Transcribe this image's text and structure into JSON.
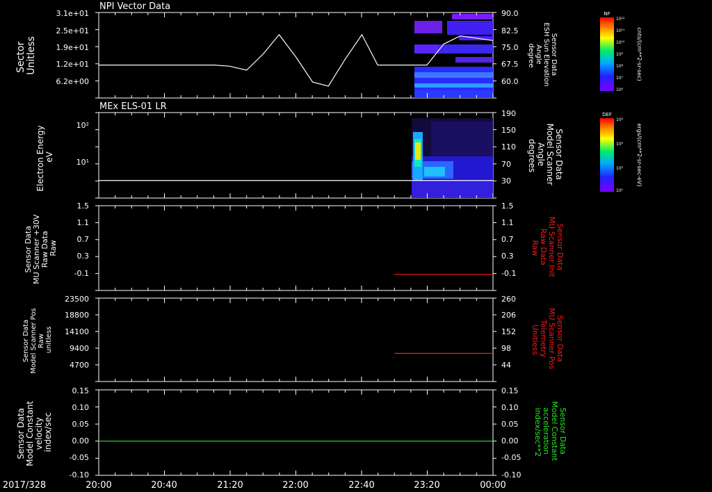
{
  "date_label": "2017/328",
  "time_ticks": [
    "20:00",
    "20:40",
    "21:20",
    "22:00",
    "22:40",
    "23:20",
    "00:00"
  ],
  "colors": {
    "axis": "#ffffff",
    "red": "#ff1a1a",
    "green": "#22ee22",
    "bg": "#000000"
  },
  "chart_data": [
    {
      "type": "line",
      "title": "NPI Vector Data",
      "ylabel_left": [
        "Sector",
        "Unitless"
      ],
      "ylabel_right": [
        "Sensor Data",
        "ESH Sun Elevation",
        "Angle",
        "degree"
      ],
      "left_ticks": [
        "3.1e+01",
        "2.5e+01",
        "1.9e+01",
        "1.2e+01",
        "6.2e+00"
      ],
      "right_ticks": [
        "90.0",
        "82.5",
        "75.0",
        "67.5",
        "60.0"
      ],
      "right_ylim": [
        53.4,
        90.0
      ],
      "x_hours": [
        20.0,
        20.33,
        20.83,
        21.17,
        21.33,
        21.5,
        21.67,
        21.83,
        22.0,
        22.17,
        22.33,
        22.5,
        22.67,
        22.83,
        23.0,
        23.17,
        23.33,
        23.5,
        23.67,
        24.0
      ],
      "series": [
        {
          "values": [
            67.5,
            67.5,
            67.5,
            67.5,
            67.0,
            65.3,
            72.3,
            80.5,
            71.0,
            60.2,
            58.5,
            70.0,
            80.5,
            67.5,
            67.5,
            67.5,
            67.5,
            76.5,
            80.0,
            78.0
          ]
        }
      ],
      "spectrogram": {
        "x_range": [
          "23:10",
          "00:00"
        ],
        "colorbar_label": "NF",
        "colorbar_units": "cnts/(cm**2-sr-sec)",
        "colorbar_ticks": [
          "10¹²",
          "10¹¹",
          "10¹⁰",
          "10⁹",
          "10⁸",
          "10⁷",
          "10⁶"
        ]
      }
    },
    {
      "type": "heatmap",
      "title": "MEx ELS-01 LR",
      "ylabel_left": [
        "Electron Energy",
        "eV"
      ],
      "ylabel_right": [
        "Sensor Data",
        "Model Scanner",
        "Angle",
        "degrees"
      ],
      "left_ticks": [
        "10²",
        "10¹"
      ],
      "right_ticks": [
        "190",
        "150",
        "110",
        "70",
        "30"
      ],
      "line_value": 3,
      "spectrogram": {
        "x_range": [
          "23:10",
          "00:00"
        ],
        "colorbar_label": "DEF",
        "colorbar_units": "ergs/(cm**2-sr-sec-eV)",
        "colorbar_ticks": [
          "10⁴",
          "10³",
          "10²",
          "10¹"
        ]
      }
    },
    {
      "type": "line",
      "ylabel_left": [
        "Sensor Data",
        "MU Scanner +30V",
        "Raw Data",
        "Raw"
      ],
      "ylabel_right": [
        "Sensor Data",
        "MU Scanner Init",
        "Raw Data",
        "Raw"
      ],
      "left_ticks": [
        "1.5",
        "1.1",
        "0.7",
        "0.3",
        "-0.1"
      ],
      "right_ticks": [
        "1.5",
        "1.1",
        "0.7",
        "0.3",
        "-0.1"
      ],
      "ylim": [
        -0.35,
        1.5
      ],
      "series": [
        {
          "x_range": [
            "23:00",
            "00:00"
          ],
          "value": 0.0
        }
      ]
    },
    {
      "type": "line",
      "ylabel_left": [
        "Sensor Data",
        "Model Scanner Pos",
        "Raw",
        "unitless"
      ],
      "ylabel_right": [
        "Sensor Data",
        "MU Scanner Pos",
        "Telemetry",
        "Unitless"
      ],
      "left_ticks": [
        "23500",
        "18800",
        "14100",
        "9400",
        "4700"
      ],
      "right_ticks": [
        "260",
        "206",
        "152",
        "98",
        "44"
      ],
      "right_ylim": [
        5,
        260
      ],
      "series": [
        {
          "x_range": [
            "23:00",
            "00:00"
          ],
          "value": 91
        }
      ]
    },
    {
      "type": "line",
      "ylabel_left": [
        "Sensor Data",
        "Model Constant",
        "velocity",
        "index/sec"
      ],
      "ylabel_right": [
        "Sensor Data",
        "Model Constant",
        "acceleration",
        "index/sec**2"
      ],
      "left_ticks": [
        "0.15",
        "0.10",
        "0.05",
        "0.00",
        "-0.05",
        "-0.10"
      ],
      "right_ticks": [
        "0.15",
        "0.10",
        "0.05",
        "0.00",
        "-0.05",
        "-0.10"
      ],
      "ylim": [
        -0.1,
        0.15
      ],
      "series": [
        {
          "x_range": [
            "20:00",
            "00:00"
          ],
          "value": 0.0
        }
      ]
    }
  ]
}
